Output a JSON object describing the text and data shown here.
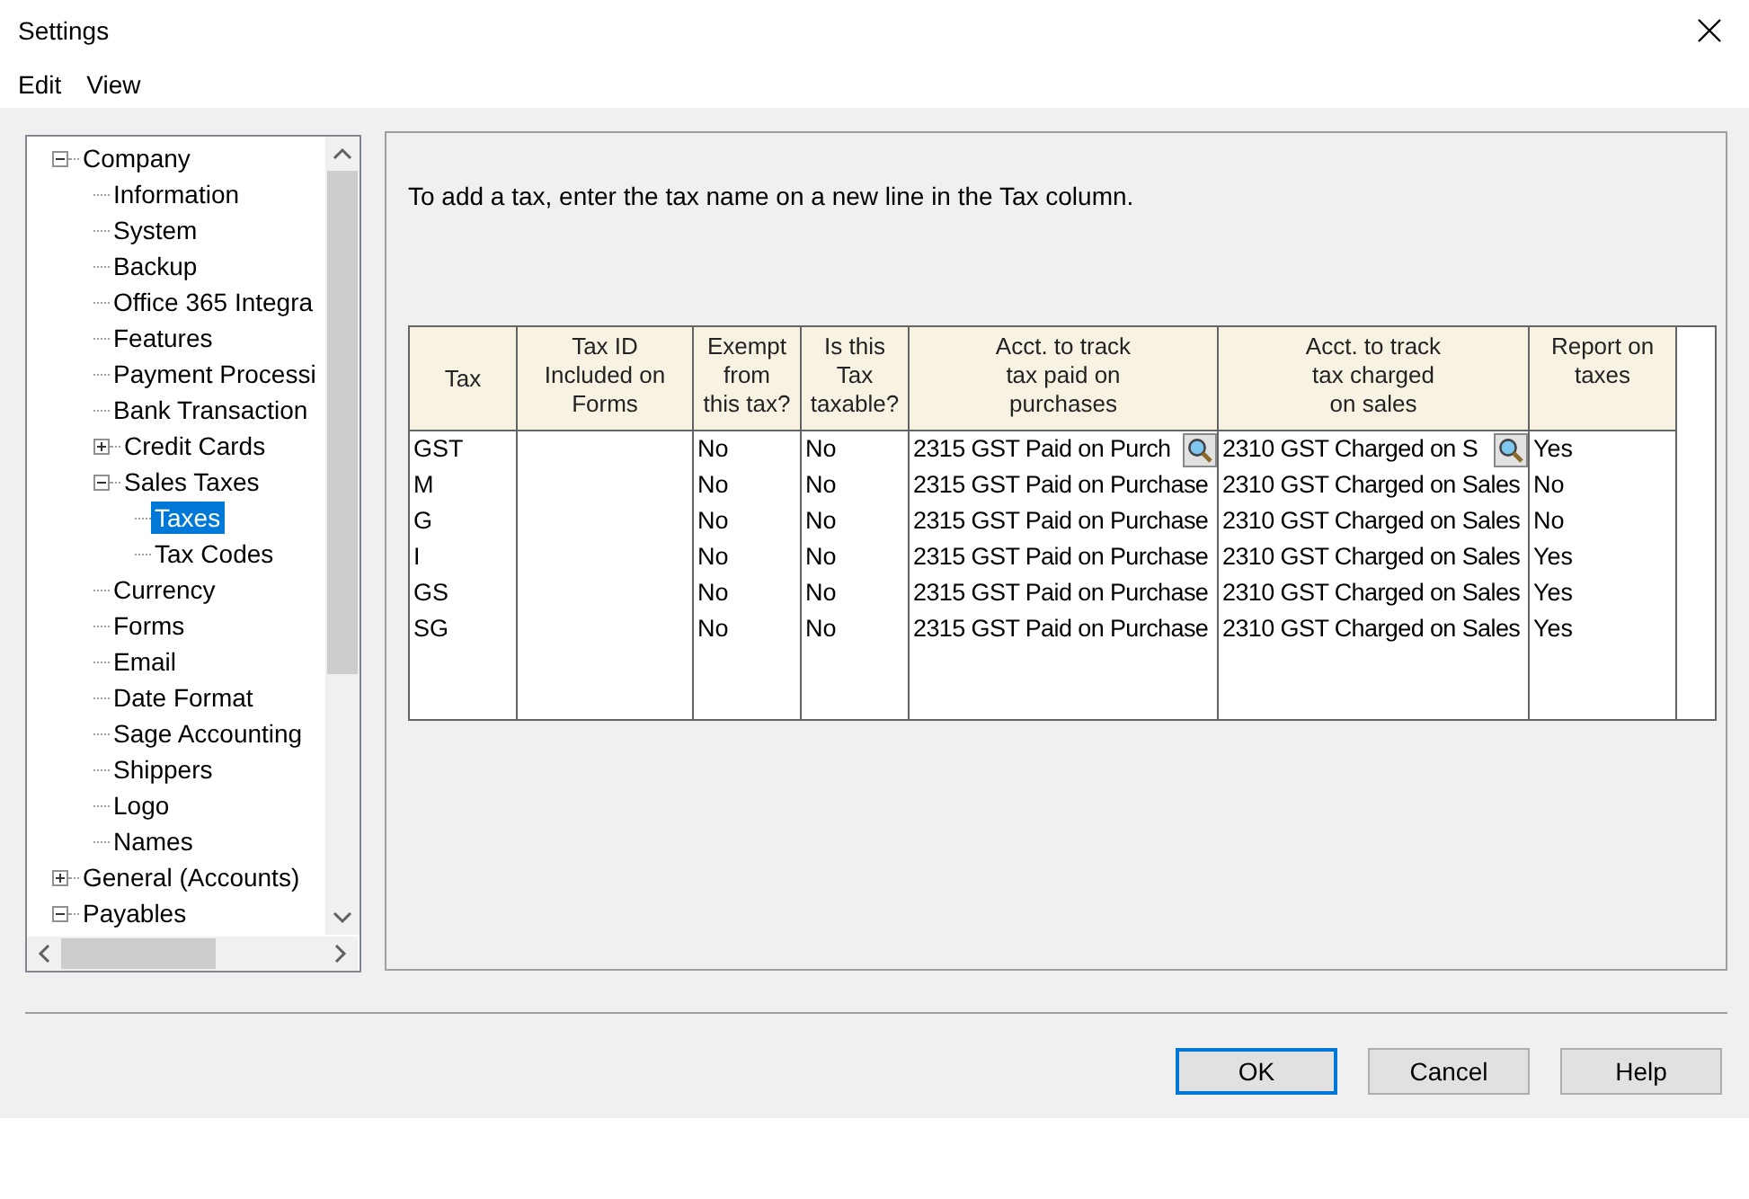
{
  "window": {
    "title": "Settings"
  },
  "menu": [
    "Edit",
    "View"
  ],
  "tree": [
    {
      "label": "Company",
      "expanded": true,
      "selected": false,
      "children": [
        {
          "label": "Information",
          "selected": false
        },
        {
          "label": "System",
          "selected": false
        },
        {
          "label": "Backup",
          "selected": false
        },
        {
          "label": "Office 365 Integra",
          "selected": false
        },
        {
          "label": "Features",
          "selected": false
        },
        {
          "label": "Payment Processi",
          "selected": false
        },
        {
          "label": "Bank Transaction",
          "selected": false
        },
        {
          "label": "Credit Cards",
          "expanded": false,
          "selected": false
        },
        {
          "label": "Sales Taxes",
          "expanded": true,
          "selected": false,
          "children": [
            {
              "label": "Taxes",
              "selected": true
            },
            {
              "label": "Tax Codes",
              "selected": false
            }
          ]
        },
        {
          "label": "Currency",
          "selected": false
        },
        {
          "label": "Forms",
          "selected": false
        },
        {
          "label": "Email",
          "selected": false
        },
        {
          "label": "Date Format",
          "selected": false
        },
        {
          "label": "Sage Accounting",
          "selected": false
        },
        {
          "label": "Shippers",
          "selected": false
        },
        {
          "label": "Logo",
          "selected": false
        },
        {
          "label": "Names",
          "selected": false
        }
      ]
    },
    {
      "label": "General (Accounts)",
      "expanded": false,
      "selected": false
    },
    {
      "label": "Payables",
      "expanded": true,
      "selected": false
    }
  ],
  "instruction": "To add a tax, enter the tax name on a new line in the Tax column.",
  "table": {
    "columns": [
      "Tax",
      "Tax ID\nIncluded on\nForms",
      "Exempt\nfrom\nthis tax?",
      "Is this\nTax\ntaxable?",
      "Acct. to track\ntax paid on\npurchases",
      "Acct. to track\ntax charged\non sales",
      "Report on\ntaxes"
    ],
    "rows": [
      {
        "current": true,
        "cells": [
          "GST",
          "",
          "No",
          "No",
          "2315 GST Paid on Purch",
          "2310 GST Charged on S",
          "Yes"
        ]
      },
      {
        "current": false,
        "cells": [
          "M",
          "",
          "No",
          "No",
          "2315 GST Paid on Purchase",
          "2310 GST Charged on Sales",
          "No"
        ]
      },
      {
        "current": false,
        "cells": [
          "G",
          "",
          "No",
          "No",
          "2315 GST Paid on Purchase",
          "2310 GST Charged on Sales",
          "No"
        ]
      },
      {
        "current": false,
        "cells": [
          "I",
          "",
          "No",
          "No",
          "2315 GST Paid on Purchase",
          "2310 GST Charged on Sales",
          "Yes"
        ]
      },
      {
        "current": false,
        "cells": [
          "GS",
          "",
          "No",
          "No",
          "2315 GST Paid on Purchase",
          "2310 GST Charged on Sales",
          "Yes"
        ]
      },
      {
        "current": false,
        "cells": [
          "SG",
          "",
          "No",
          "No",
          "2315 GST Paid on Purchase",
          "2310 GST Charged on Sales",
          "Yes"
        ]
      }
    ]
  },
  "buttons": [
    {
      "label": "OK",
      "default": true
    },
    {
      "label": "Cancel",
      "default": false
    },
    {
      "label": "Help",
      "default": false
    }
  ]
}
